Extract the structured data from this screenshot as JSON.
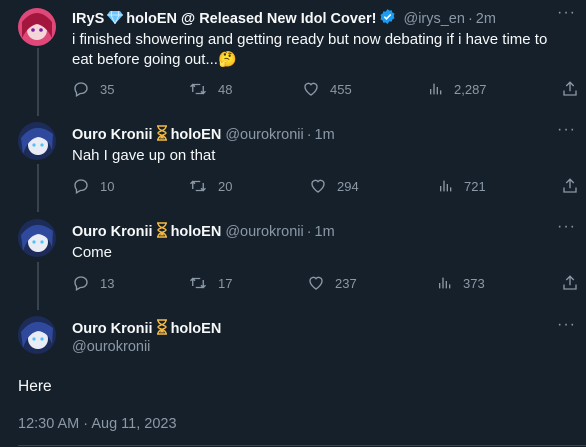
{
  "tweets": [
    {
      "name": "IRyS",
      "name_suffix": "holoEN @ Released New Idol Cover!",
      "handle": "@irys_en",
      "time": "2m",
      "text": "i finished showering and getting ready but now debating if i have time to eat before going out...",
      "emoji": "🤔",
      "replies": "35",
      "retweets": "48",
      "likes": "455",
      "views": "2,287",
      "avatar_color": "#c2185b",
      "verified": true
    },
    {
      "name": "Ouro Kronii",
      "name_suffix": "holoEN",
      "handle": "@ourokronii",
      "time": "1m",
      "text": "Nah I gave up on that",
      "replies": "10",
      "retweets": "20",
      "likes": "294",
      "views": "721",
      "avatar_color": "#2e3d78"
    },
    {
      "name": "Ouro Kronii",
      "name_suffix": "holoEN",
      "handle": "@ourokronii",
      "time": "1m",
      "text": "Come",
      "replies": "13",
      "retweets": "17",
      "likes": "237",
      "views": "373",
      "avatar_color": "#2e3d78"
    }
  ],
  "main_tweet": {
    "name": "Ouro Kronii",
    "name_suffix": "holoEN",
    "handle": "@ourokronii",
    "text": "Here",
    "timestamp": "12:30 AM · Aug 11, 2023"
  },
  "more_label": "···",
  "dot_sep": "·",
  "colors": {
    "background": "#15202b",
    "text": "#f7f9f9",
    "muted": "#8b98a5",
    "line": "#38444d",
    "verified": "#1d9bf0"
  }
}
